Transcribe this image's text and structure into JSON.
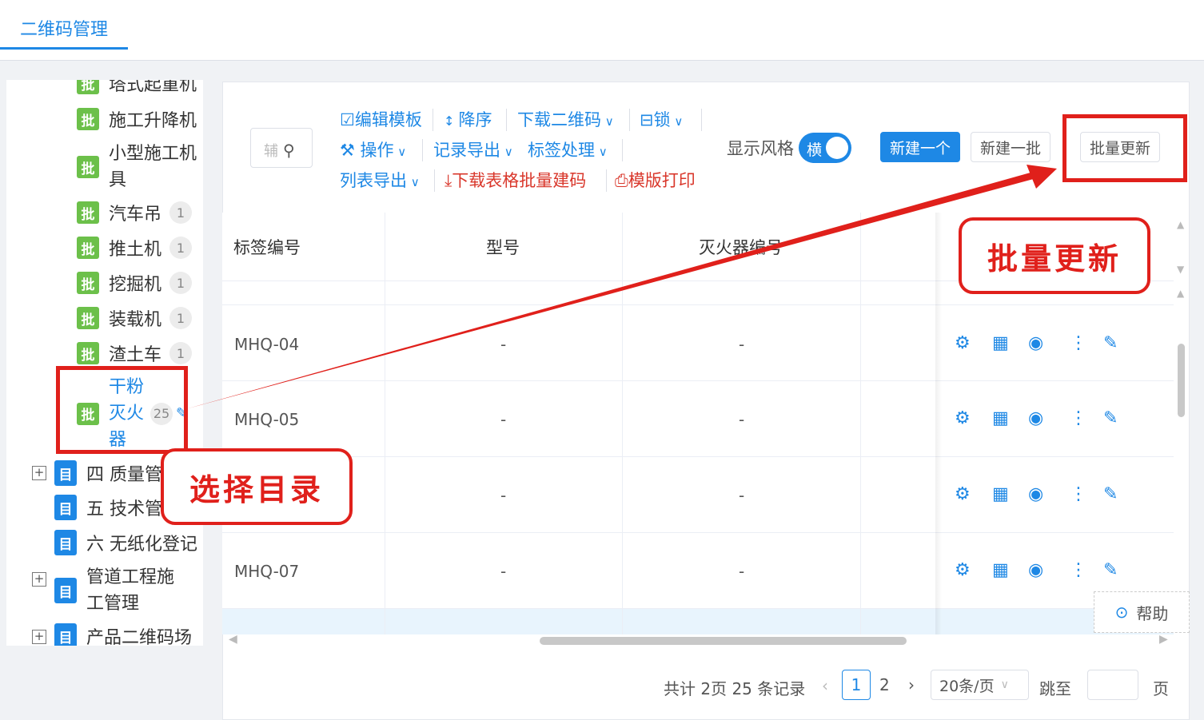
{
  "tab": {
    "label": "二维码管理"
  },
  "sidebar": {
    "batch_tag": "批",
    "dir_tag": "目",
    "items": [
      {
        "label": "塔式起重机"
      },
      {
        "label": "施工升降机"
      },
      {
        "label": "小型施工机具"
      },
      {
        "label": "汽车吊",
        "count": "1"
      },
      {
        "label": "推土机",
        "count": "1"
      },
      {
        "label": "挖掘机",
        "count": "1"
      },
      {
        "label": "装载机",
        "count": "1"
      },
      {
        "label": "渣土车",
        "count": "1"
      },
      {
        "label": "干粉灭火器",
        "count": "25"
      }
    ],
    "dirs": [
      {
        "label": "四 质量管理"
      },
      {
        "label": "五 技术管理"
      },
      {
        "label": "六 无纸化登记"
      },
      {
        "label": "管道工程施工管理"
      },
      {
        "label": "产品二维码场"
      }
    ]
  },
  "toolbar": {
    "search_placeholder": "辅",
    "edit_template": "编辑模板",
    "sort_desc": "降序",
    "download_qr": "下载二维码",
    "lock": "锁",
    "operate": "操作",
    "export_records": "记录导出",
    "tag_process": "标签处理",
    "export_list": "列表导出",
    "download_sheet": "下载表格批量建码",
    "template_print": "模版打印",
    "display_style": "显示风格",
    "toggle_label": "横",
    "new_one": "新建一个",
    "new_batch": "新建一批",
    "batch_update": "批量更新"
  },
  "table": {
    "headers": [
      "标签编号",
      "型号",
      "灭火器编号"
    ],
    "rows": [
      {
        "id": "MHQ-04",
        "model": "-",
        "ext_no": "-"
      },
      {
        "id": "MHQ-05",
        "model": "-",
        "ext_no": "-"
      },
      {
        "id": "",
        "model": "-",
        "ext_no": "-"
      },
      {
        "id": "MHQ-07",
        "model": "-",
        "ext_no": "-"
      }
    ]
  },
  "pagination": {
    "summary": "共计 2页 25 条记录",
    "page1": "1",
    "page2": "2",
    "page_size": "20条/页",
    "goto": "跳至",
    "page_unit": "页"
  },
  "help": {
    "label": "帮助"
  },
  "annotations": {
    "batch_update_callout": "批量更新",
    "select_dir_callout": "选择目录",
    "color": "#e0201b"
  }
}
